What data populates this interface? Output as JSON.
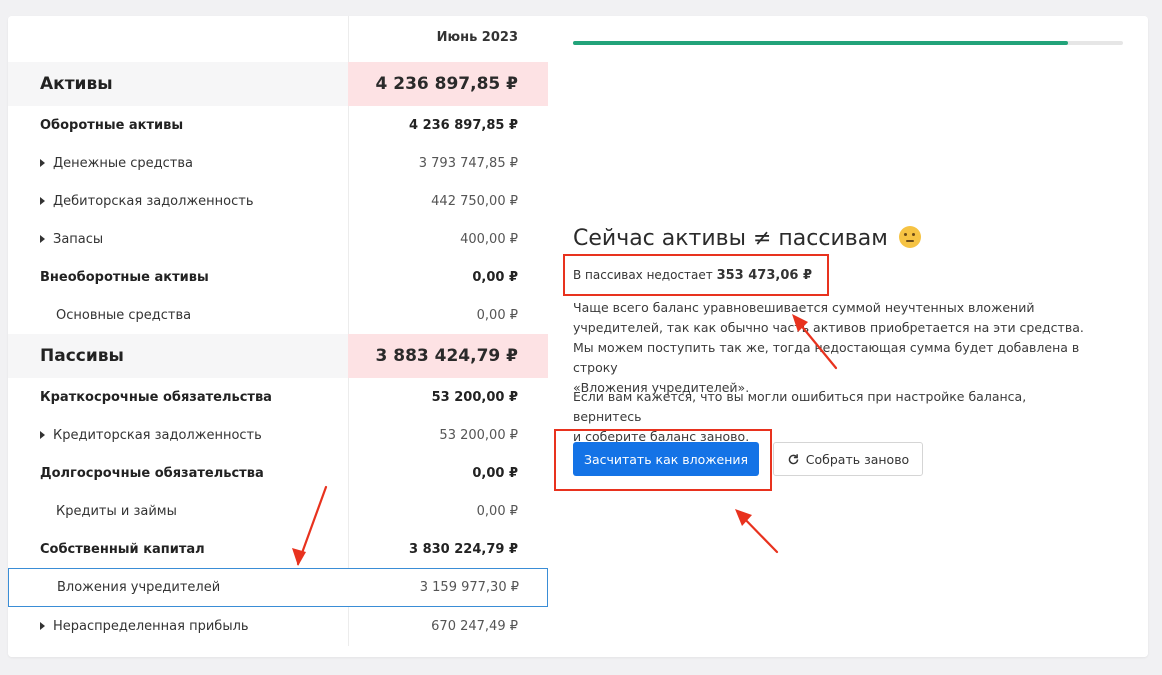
{
  "table": {
    "period": "Июнь 2023",
    "rows": [
      {
        "type": "section",
        "label": "Активы",
        "value": "4 236 897,85 ₽"
      },
      {
        "type": "group",
        "label": "Оборотные активы",
        "value": "4 236 897,85 ₽"
      },
      {
        "type": "item",
        "label": "Денежные средства",
        "value": "3 793 747,85 ₽",
        "expandable": true
      },
      {
        "type": "item",
        "label": "Дебиторская задолженность",
        "value": "442 750,00 ₽",
        "expandable": true
      },
      {
        "type": "item",
        "label": "Запасы",
        "value": "400,00 ₽",
        "expandable": true
      },
      {
        "type": "group",
        "label": "Внеоборотные активы",
        "value": "0,00 ₽"
      },
      {
        "type": "sub",
        "label": "Основные средства",
        "value": "0,00 ₽"
      },
      {
        "type": "section",
        "label": "Пассивы",
        "value": "3 883 424,79 ₽"
      },
      {
        "type": "group",
        "label": "Краткосрочные обязательства",
        "value": "53 200,00 ₽"
      },
      {
        "type": "item",
        "label": "Кредиторская задолженность",
        "value": "53 200,00 ₽",
        "expandable": true
      },
      {
        "type": "group",
        "label": "Долгосрочные обязательства",
        "value": "0,00 ₽"
      },
      {
        "type": "sub",
        "label": "Кредиты и займы",
        "value": "0,00 ₽"
      },
      {
        "type": "group",
        "label": "Собственный капитал",
        "value": "3 830 224,79 ₽"
      },
      {
        "type": "sub",
        "label": "Вложения учредителей",
        "value": "3 159 977,30 ₽",
        "selected": true
      },
      {
        "type": "item",
        "label": "Нераспределенная прибыль",
        "value": "670 247,49 ₽",
        "expandable": true
      }
    ]
  },
  "panel": {
    "progress": 0.9,
    "title": "Сейчас активы ≠ пассивам",
    "title_icon": "thinking-face-icon",
    "shortage_label": "В пассивах недостает",
    "shortage_value": "353 473,06 ₽",
    "paragraph1": [
      "Чаще всего баланс уравновешивается суммой неучтенных вложений",
      "учредителей, так как обычно часть активов приобретается на эти средства.",
      "Мы можем поступить так же, тогда недостающая сумма будет добавлена в строку",
      "«Вложения учредителей»."
    ],
    "paragraph2": [
      "Если вам кажется, что вы могли ошибиться при настройке баланса, вернитесь",
      "и соберите баланс заново."
    ],
    "primary_button": "Засчитать как вложения",
    "secondary_button": "Собрать заново",
    "secondary_icon": "refresh-icon"
  },
  "colors": {
    "accent": "#1473e6",
    "progress": "#22a37a",
    "section_value_bg": "#fde2e4",
    "annotation": "#e8321e",
    "selected_border": "#3a8dd6"
  }
}
